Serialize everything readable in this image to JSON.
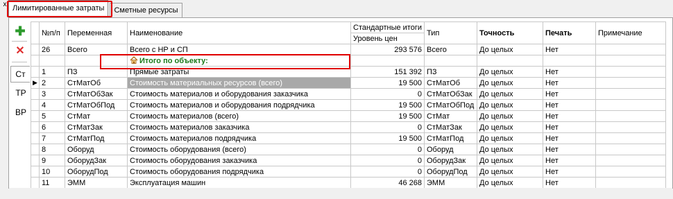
{
  "window": {
    "close_glyph": "x"
  },
  "tabs": [
    {
      "label": "Лимитированные затраты",
      "active": true
    },
    {
      "label": "Сметные ресурсы",
      "active": false
    }
  ],
  "side_panel": {
    "add_icon": "plus-icon",
    "delete_icon": "delete-icon",
    "tabs": [
      "Ст",
      "ТР",
      "ВР"
    ]
  },
  "table": {
    "headers": {
      "num": "№п/п",
      "var": "Переменная",
      "name": "Наименование",
      "std_top": "Стандартные итоги",
      "std_bottom": "Уровень цен",
      "type": "Тип",
      "precision": "Точность",
      "print": "Печать",
      "note": "Примечание"
    },
    "summary_row": {
      "num": "26",
      "var": "Всего",
      "name": "Всего с НР и СП",
      "value": "293 576",
      "type": "Всего",
      "precision": "До целых",
      "print": "Нет"
    },
    "group_row": {
      "title": "Итого по объекту:"
    },
    "rows": [
      {
        "num": "1",
        "var": "ПЗ",
        "name": "Прямые затраты",
        "value": "151 392",
        "type": "ПЗ",
        "precision": "До целых",
        "print": "Нет",
        "selected": false
      },
      {
        "num": "2",
        "var": "СтМатОб",
        "name": "Стоимость материальных ресурсов (всего)",
        "value": "19 500",
        "type": "СтМатОб",
        "precision": "До целых",
        "print": "Нет",
        "selected": true
      },
      {
        "num": "3",
        "var": "СтМатОбЗак",
        "name": "Стоимость материалов и оборудования заказчика",
        "value": "0",
        "type": "СтМатОбЗак",
        "precision": "До целых",
        "print": "Нет",
        "selected": false
      },
      {
        "num": "4",
        "var": "СтМатОбПод",
        "name": "Стоимость материалов и оборудования подрядчика",
        "value": "19 500",
        "type": "СтМатОбПод",
        "precision": "До целых",
        "print": "Нет",
        "selected": false
      },
      {
        "num": "5",
        "var": "СтМат",
        "name": "Стоимость материалов (всего)",
        "value": "19 500",
        "type": "СтМат",
        "precision": "До целых",
        "print": "Нет",
        "selected": false
      },
      {
        "num": "6",
        "var": "СтМатЗак",
        "name": "Стоимость материалов заказчика",
        "value": "0",
        "type": "СтМатЗак",
        "precision": "До целых",
        "print": "Нет",
        "selected": false
      },
      {
        "num": "7",
        "var": "СтМатПод",
        "name": "Стоимость материалов подрядчика",
        "value": "19 500",
        "type": "СтМатПод",
        "precision": "До целых",
        "print": "Нет",
        "selected": false
      },
      {
        "num": "8",
        "var": "Оборуд",
        "name": "Стоимость оборудования (всего)",
        "value": "0",
        "type": "Оборуд",
        "precision": "До целых",
        "print": "Нет",
        "selected": false
      },
      {
        "num": "9",
        "var": "ОборудЗак",
        "name": "Стоимость оборудования заказчика",
        "value": "0",
        "type": "ОборудЗак",
        "precision": "До целых",
        "print": "Нет",
        "selected": false
      },
      {
        "num": "10",
        "var": "ОборудПод",
        "name": "Стоимость оборудования подрядчика",
        "value": "0",
        "type": "ОборудПод",
        "precision": "До целых",
        "print": "Нет",
        "selected": false
      },
      {
        "num": "11",
        "var": "ЭММ",
        "name": "Эксплуатация машин",
        "value": "46 268",
        "type": "ЭММ",
        "precision": "До целых",
        "print": "Нет",
        "selected": false
      }
    ]
  }
}
